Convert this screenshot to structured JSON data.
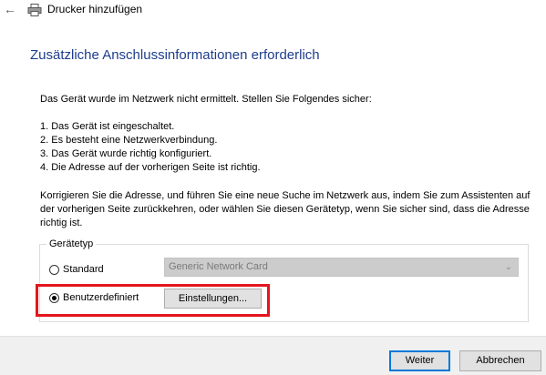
{
  "window": {
    "title": "Drucker hinzufügen",
    "back_icon": "back-arrow-icon",
    "app_icon": "printer-icon"
  },
  "heading": "Zusätzliche Anschlussinformationen erforderlich",
  "intro": "Das Gerät wurde im Netzwerk nicht ermittelt. Stellen Sie Folgendes sicher:",
  "checklist": [
    "1.  Das Gerät ist eingeschaltet.",
    "2.  Es besteht eine Netzwerkverbindung.",
    "3.  Das Gerät wurde richtig konfiguriert.",
    "4.  Die Adresse auf der vorherigen Seite ist richtig."
  ],
  "instructions": "Korrigieren Sie die Adresse, und führen Sie eine neue Suche im Netzwerk aus, indem Sie zum Assistenten auf der vorherigen Seite zurückkehren, oder wählen Sie diesen Gerätetyp, wenn Sie sicher sind, dass die Adresse richtig ist.",
  "device_type": {
    "label": "Gerätetyp",
    "standard_label": "Standard",
    "standard_selected": false,
    "standard_value": "Generic Network Card",
    "custom_label": "Benutzerdefiniert",
    "custom_selected": true,
    "settings_button": "Einstellungen..."
  },
  "footer": {
    "next_button": "Weiter",
    "cancel_button": "Abbrechen"
  },
  "colors": {
    "heading": "#1e3d8c",
    "highlight": "#e4151d",
    "focus_border": "#0078d7"
  }
}
